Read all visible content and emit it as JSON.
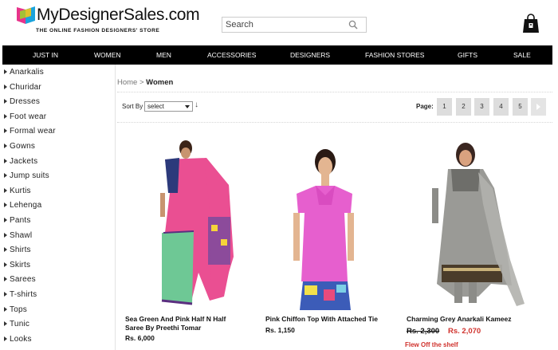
{
  "header": {
    "logo_name": "MyDesignerSales.com",
    "logo_tagline": "THE ONLINE FASHION DESIGNERS' STORE",
    "search_placeholder": "Search",
    "icons": {
      "search": "search-icon",
      "bag": "shopping-bag-icon"
    }
  },
  "nav": {
    "items": [
      "JUST IN",
      "WOMEN",
      "MEN",
      "ACCESSORIES",
      "DESIGNERS",
      "FASHION STORES",
      "GIFTS",
      "SALE"
    ]
  },
  "sidebar": {
    "items": [
      "Anarkalis",
      "Churidar",
      "Dresses",
      "Foot wear",
      "Formal wear",
      "Gowns",
      "Jackets",
      "Jump suits",
      "Kurtis",
      "Lehenga",
      "Pants",
      "Shawl",
      "Shirts",
      "Skirts",
      "Sarees",
      "T-shirts",
      "Tops",
      "Tunic",
      "Looks"
    ]
  },
  "breadcrumb": {
    "home": "Home",
    "separator": " > ",
    "current": "Women"
  },
  "sort": {
    "label": "Sort By",
    "selected": "select",
    "arrow": "↓"
  },
  "pagination": {
    "label": "Page:",
    "pages": [
      "1",
      "2",
      "3",
      "4",
      "5"
    ],
    "next_icon": "next-arrow-icon"
  },
  "products": [
    {
      "name_line1": "Sea Green And Pink Half N Half",
      "name_line2": "Saree By Preethi Tomar",
      "price": "Rs. 6,000"
    },
    {
      "name_line1": "Pink Chiffon Top With Attached Tie",
      "price": "Rs. 1,150"
    },
    {
      "name_line1": "Charming Grey Anarkali Kameez",
      "old_price": "Rs. 2,300",
      "new_price": "Rs. 2,070",
      "tag": "Flew Off the shelf"
    }
  ],
  "colors": {
    "nav_bg": "#000000",
    "sale_red": "#d0322d",
    "page_btn": "#dddddd"
  }
}
